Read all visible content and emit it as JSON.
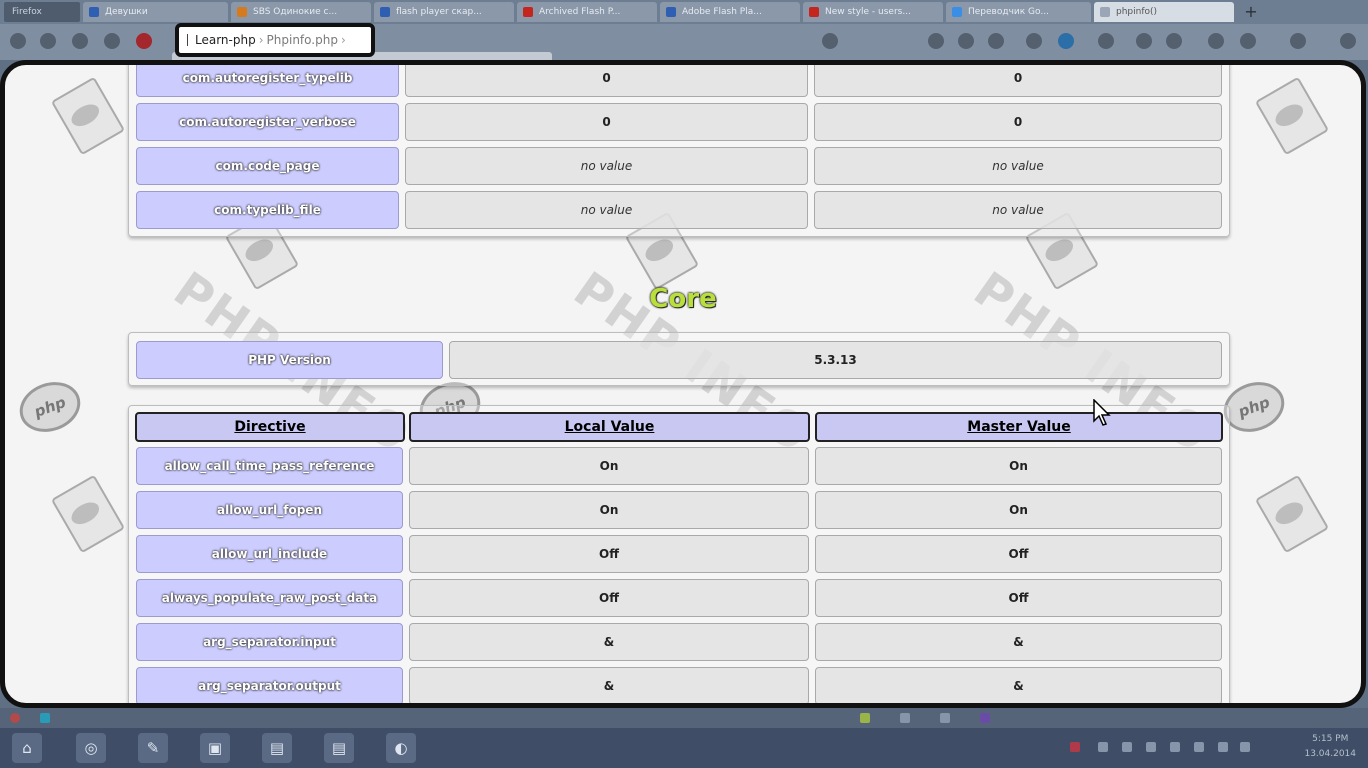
{
  "browser": {
    "firefox_label": "Firefox",
    "tabs": [
      {
        "label": "Девушки",
        "color": "#2f5fb3"
      },
      {
        "label": "SBS Одинокие с...",
        "color": "#d57a1e"
      },
      {
        "label": "flash player скар...",
        "color": "#2f5fb3"
      },
      {
        "label": "Archived Flash P...",
        "color": "#c4261d"
      },
      {
        "label": "Adobe Flash Pla...",
        "color": "#2f5fb3"
      },
      {
        "label": "New style - users...",
        "color": "#c4261d"
      },
      {
        "label": "Переводчик Go...",
        "color": "#3a8ee6"
      },
      {
        "label": "phpinfo()",
        "color": "#9aa6b6"
      }
    ],
    "new_tab_symbol": "+",
    "breadcrumb": [
      "Learn-php",
      "Phpinfo.php"
    ]
  },
  "top_table": {
    "rows": [
      {
        "directive": "com.autoregister_typelib",
        "local": "0",
        "master": "0"
      },
      {
        "directive": "com.autoregister_verbose",
        "local": "0",
        "master": "0"
      },
      {
        "directive": "com.code_page",
        "local": "no value",
        "master": "no value"
      },
      {
        "directive": "com.typelib_file",
        "local": "no value",
        "master": "no value"
      }
    ]
  },
  "core": {
    "title": "Core",
    "php_version_label": "PHP Version",
    "php_version_value": "5.3.13",
    "headers": [
      "Directive",
      "Local Value",
      "Master Value"
    ],
    "rows": [
      {
        "directive": "allow_call_time_pass_reference",
        "local": "On",
        "master": "On"
      },
      {
        "directive": "allow_url_fopen",
        "local": "On",
        "master": "On"
      },
      {
        "directive": "allow_url_include",
        "local": "Off",
        "master": "Off"
      },
      {
        "directive": "always_populate_raw_post_data",
        "local": "Off",
        "master": "Off"
      },
      {
        "directive": "arg_separator.input",
        "local": "&",
        "master": "&"
      },
      {
        "directive": "arg_separator.output",
        "local": "&",
        "master": "&"
      }
    ]
  },
  "watermark": {
    "text": "PHP INFO",
    "logo_text": "php"
  },
  "taskbar": {
    "icons": [
      "home-icon",
      "browser-icon",
      "tools-icon",
      "media-icon",
      "folder-icon",
      "folder-icon",
      "player-icon"
    ],
    "clock_time": "5:15 PM",
    "clock_date": "13.04.2014"
  },
  "colors": {
    "key_bg": "#ccccff",
    "core_title": "#b8df3a",
    "frame": "#111111"
  }
}
